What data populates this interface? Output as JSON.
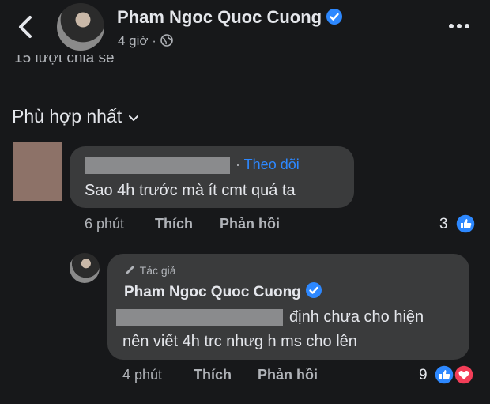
{
  "header": {
    "author_name": "Pham Ngoc Quoc Cuong",
    "post_time": "4 giờ",
    "privacy_icon": "globe-icon",
    "back_icon": "chevron-left-icon",
    "more_icon": "more-dots-icon"
  },
  "post": {
    "shares_text": "15 lượt chia sẻ"
  },
  "sort": {
    "label": "Phù hợp nhất"
  },
  "comment1": {
    "follow_label": "Theo dõi",
    "text": "Sao 4h trước mà ít cmt quá ta",
    "time": "6 phút",
    "like_label": "Thích",
    "reply_label": "Phản hồi",
    "reaction_count": "3"
  },
  "reply1": {
    "badge": "Tác giả",
    "author_name": "Pham Ngoc Quoc Cuong",
    "text_line1": "định chưa cho hiện",
    "text_line2": "nên viết 4h trc nhưg h ms  cho lên",
    "time": "4 phút",
    "like_label": "Thích",
    "reply_label": "Phản hồi",
    "reaction_count": "9"
  },
  "colors": {
    "background": "#17181a",
    "bubble": "#3a3b3c",
    "accent_blue": "#2d88ff",
    "heart_red": "#f33e58",
    "muted_text": "#b0b3b8"
  }
}
